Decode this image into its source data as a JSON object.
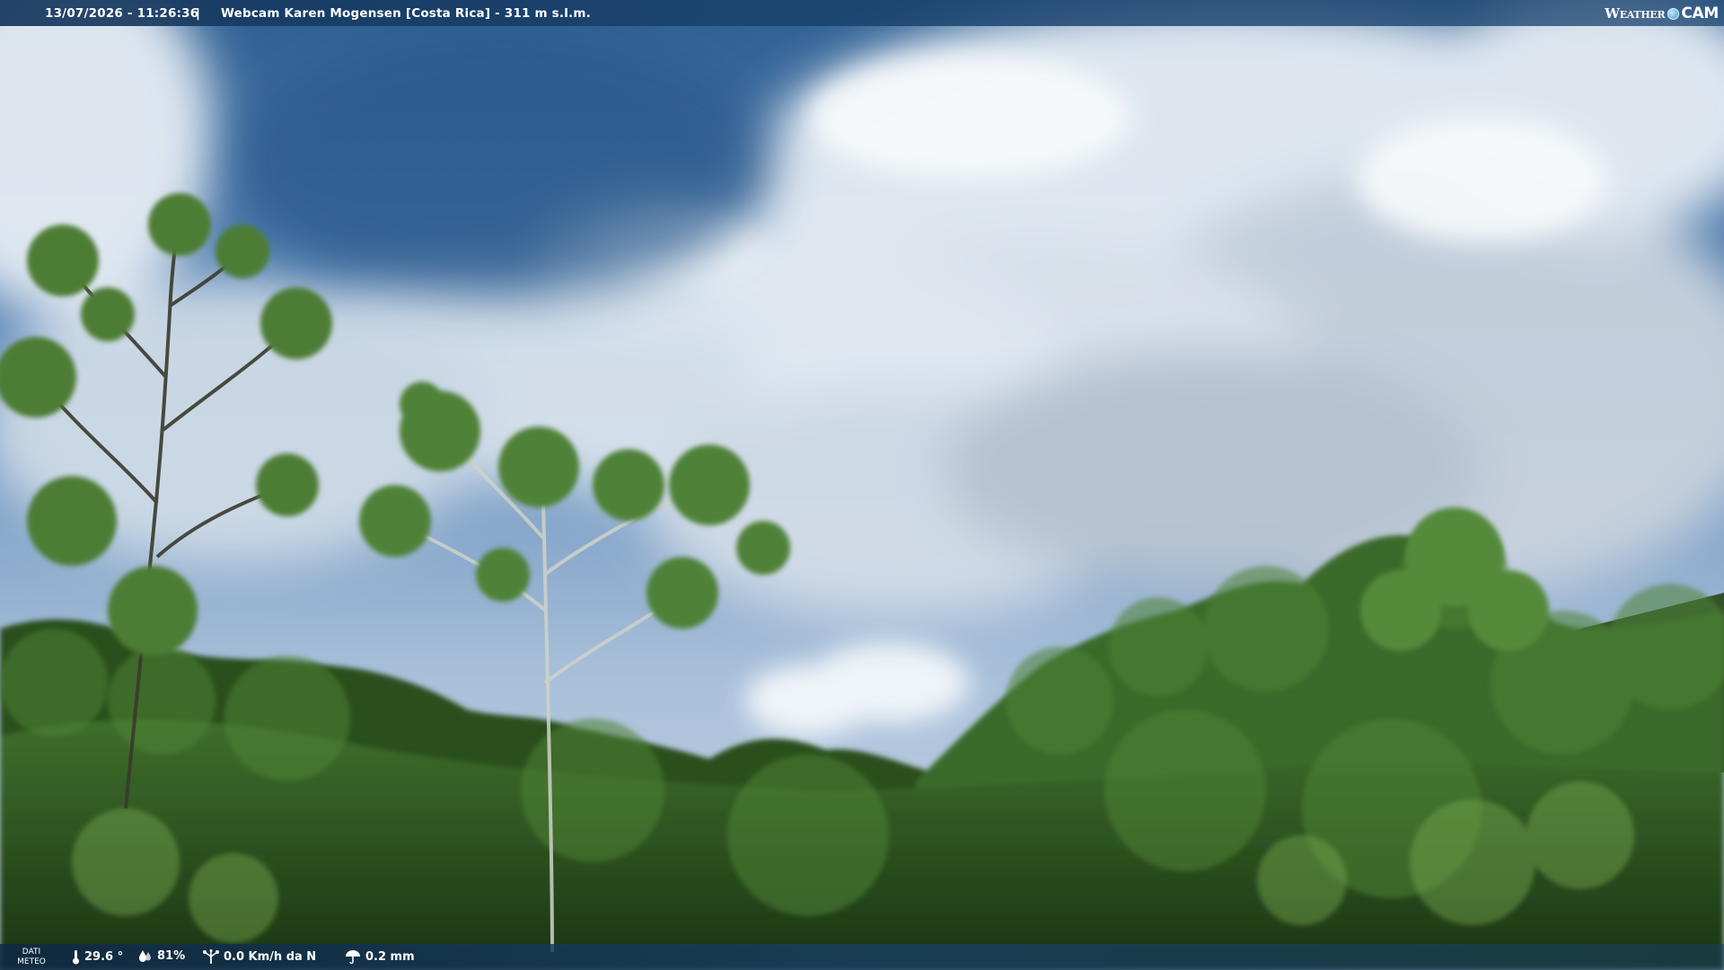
{
  "overlay": {
    "timestamp": "13/07/2026 - 11:26:36",
    "separator": "|",
    "title": "Webcam Karen Mogensen [Costa Rica]  - 311 m s.l.m.",
    "logo": {
      "weather": "Weather",
      "cam": "CAM",
      "icon": "globe-icon"
    }
  },
  "weather_bar": {
    "label_line1": "DATI",
    "label_line2": "METEO",
    "temperature": "29.6 °",
    "temperature_icon": "thermometer-icon",
    "humidity": "81%",
    "humidity_icon": "droplet-icon",
    "wind": "0.0 Km/h da N",
    "wind_icon": "anemometer-icon",
    "rain": "0.2 mm",
    "rain_icon": "umbrella-icon"
  },
  "colors": {
    "sky_deep": "#2c5e8e",
    "sky_mid": "#6f98c4",
    "cloud": "#e9eff5",
    "forest_dark": "#1f3f19",
    "forest_light": "#5d8d3a"
  }
}
